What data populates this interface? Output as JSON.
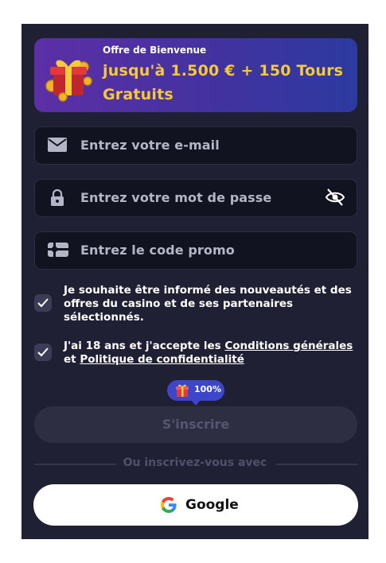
{
  "banner": {
    "small": "Offre de Bienvenue",
    "big": "jusqu'à 1.500 € + 150 Tours Gratuits"
  },
  "fields": {
    "email_placeholder": "Entrez votre e-mail",
    "password_placeholder": "Entrez votre mot de passe",
    "promo_placeholder": "Entrez le code promo"
  },
  "consent": {
    "newsletter": "Je souhaite être informé des nouveautés et des offres du casino et de ses partenaires sélectionnés.",
    "age_prefix": "J'ai 18 ans et j'accepte les ",
    "terms_link": "Conditions générales",
    "age_middle": " et ",
    "privacy_link": "Politique de confidentialité"
  },
  "badge": {
    "percent": "100%"
  },
  "signup": {
    "label": "S'inscrire"
  },
  "divider": {
    "text": "Ou inscrivez-vous avec"
  },
  "google": {
    "label": "Google"
  },
  "colors": {
    "banner_gold": "#f4c93a",
    "panel": "#1f2033",
    "field": "#121320",
    "badge": "#3d45c8"
  }
}
